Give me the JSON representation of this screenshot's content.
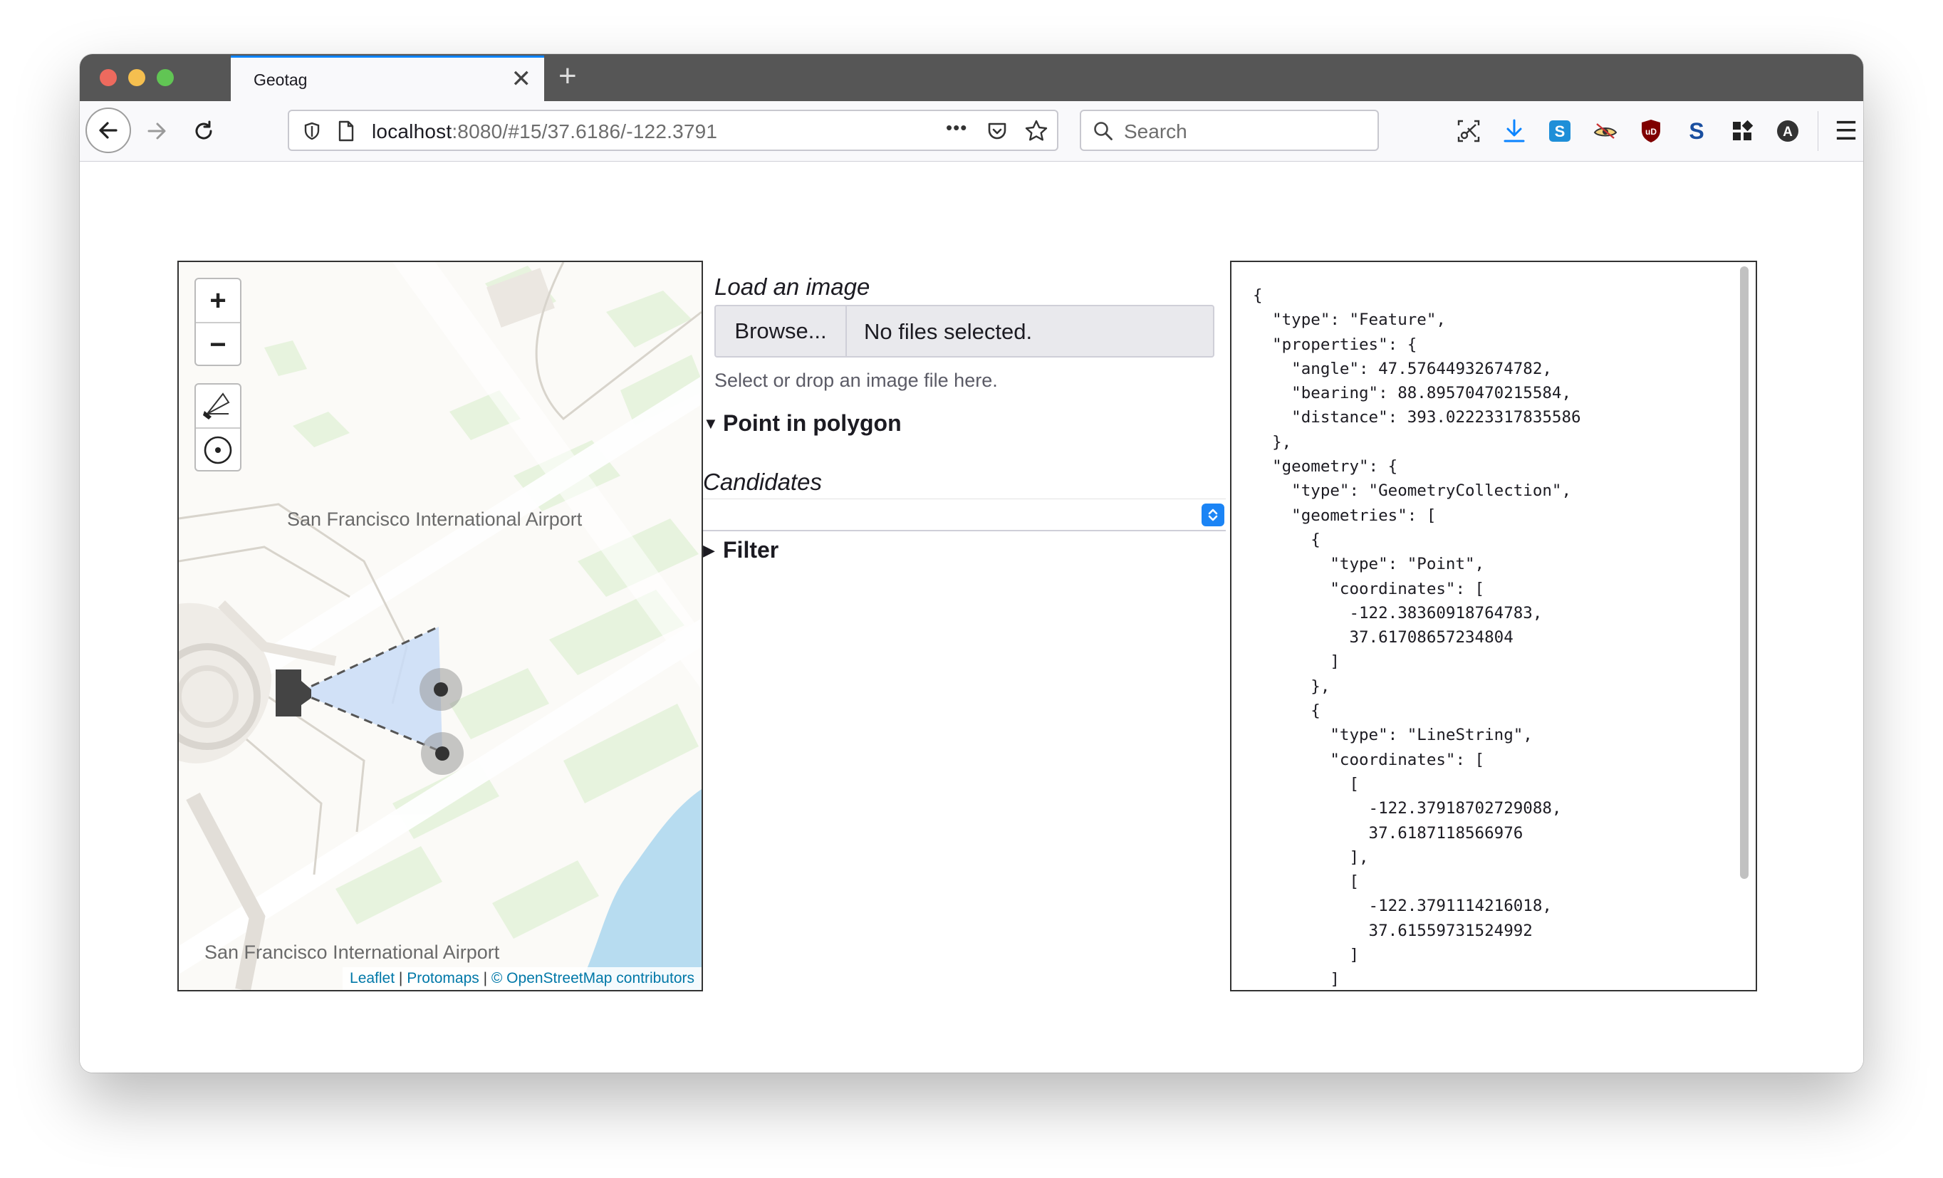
{
  "browser": {
    "tab_title": "Geotag",
    "tab_close": "✕",
    "new_tab": "+",
    "url_host": "localhost",
    "url_rest": ":8080/#15/37.6186/-122.3791",
    "url_more": "•••",
    "search_placeholder": "Search",
    "menu_icon": "☰",
    "colors": {
      "titlebar": "#565656",
      "accent": "#0a84ff",
      "toolbar": "#f9f9fb"
    }
  },
  "map": {
    "labels": [
      "San Francisco International Airport",
      "San Francisco International Airport"
    ],
    "zoom_in": "+",
    "zoom_out": "−",
    "attribution": {
      "leaflet": "Leaflet",
      "sep1": " | ",
      "protomaps": "Protomaps",
      "sep2": " | ",
      "osm": "© OpenStreetMap contributors"
    },
    "colors": {
      "land": "#fbfaf7",
      "green": "#e6f3dc",
      "water": "#b7dcf0",
      "viewshed": "#c9dcf7"
    }
  },
  "panel": {
    "load_title": "Load an image",
    "browse_label": "Browse...",
    "file_status": "No files selected.",
    "hint": "Select or drop an image file here.",
    "point_in_polygon": "Point in polygon",
    "candidates_title": "Candidates",
    "filter": "Filter",
    "expanded_marker": "▼",
    "collapsed_marker": "▶"
  },
  "json_output": "{\n  \"type\": \"Feature\",\n  \"properties\": {\n    \"angle\": 47.57644932674782,\n    \"bearing\": 88.89570470215584,\n    \"distance\": 393.02223317835586\n  },\n  \"geometry\": {\n    \"type\": \"GeometryCollection\",\n    \"geometries\": [\n      {\n        \"type\": \"Point\",\n        \"coordinates\": [\n          -122.38360918764783,\n          37.61708657234804\n        ]\n      },\n      {\n        \"type\": \"LineString\",\n        \"coordinates\": [\n          [\n            -122.37918702729088,\n            37.6187118566976\n          ],\n          [\n            -122.3791114216018,\n            37.61559731524992\n          ]\n        ]"
}
